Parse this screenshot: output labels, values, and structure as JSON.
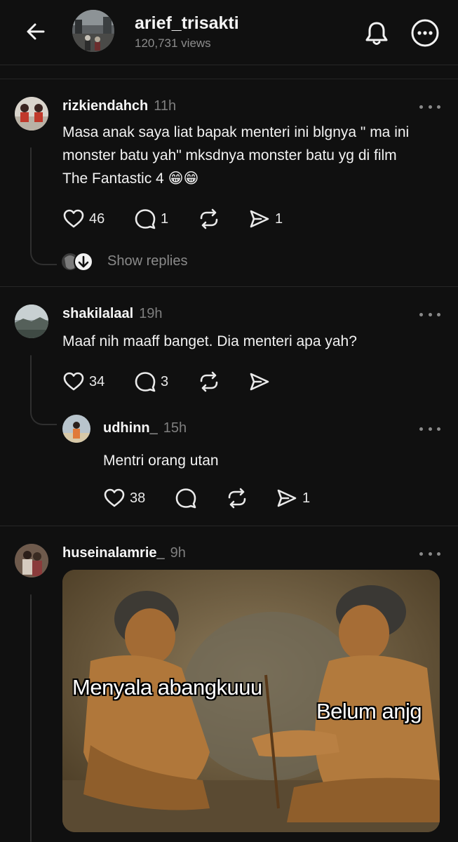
{
  "header": {
    "title": "arief_trisakti",
    "views": "120,731 views",
    "icons": {
      "back": "arrow-left-icon",
      "bell": "bell-icon",
      "more": "more-circle-icon"
    }
  },
  "posts": [
    {
      "username": "rizkiendahch",
      "time": "11h",
      "text_lines": [
        "Masa anak saya liat bapak menteri ini blgnya \" ma ini",
        "monster batu yah\" mksdnya monster batu yg di film",
        "The Fantastic 4 😁😁"
      ],
      "likes": "46",
      "replies": "1",
      "shares": "1",
      "show_replies": "Show replies"
    },
    {
      "username": "shakilalaal",
      "time": "19h",
      "text_lines": [
        "Maaf nih maaff banget. Dia menteri apa yah?"
      ],
      "likes": "34",
      "replies": "3"
    },
    {
      "username": "udhinn_",
      "time": "15h",
      "text_lines": [
        "Mentri orang utan"
      ],
      "likes": "38",
      "shares": "1"
    },
    {
      "username": "huseinalamrie_",
      "time": "9h",
      "meme": {
        "left_caption": "Menyala abangkuuu",
        "right_caption": "Belum anjg"
      }
    }
  ],
  "colors": {
    "background": "#101010",
    "muted": "#7f7f7f",
    "text": "#f2f2f2"
  }
}
